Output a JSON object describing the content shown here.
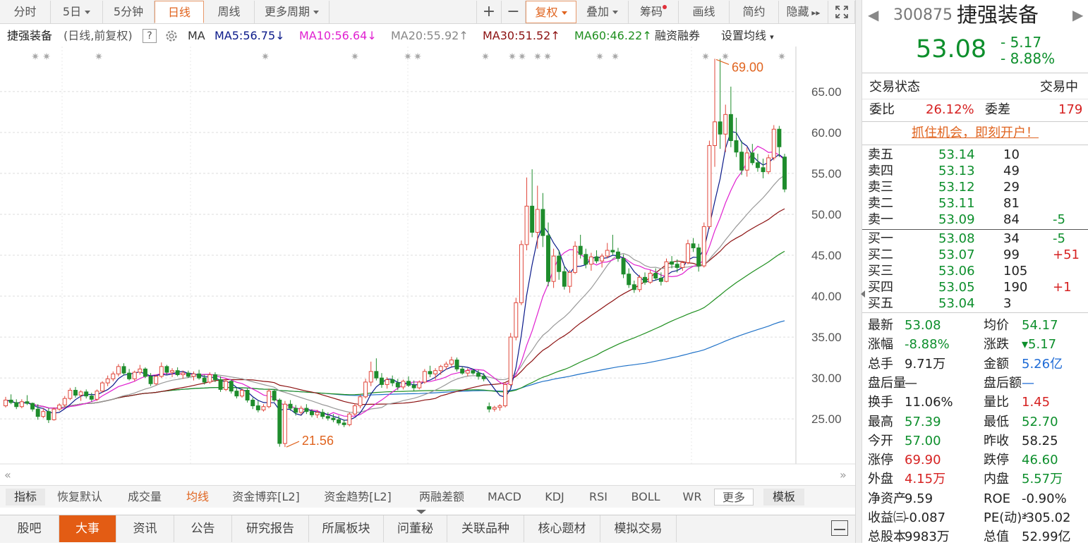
{
  "toolbar": {
    "tabs": [
      "分时",
      "5日",
      "5分钟",
      "日线",
      "周线",
      "更多周期"
    ],
    "zoom_in": "+",
    "zoom_out": "−",
    "fuquan": "复权",
    "diejia": "叠加",
    "chouma": "筹码",
    "huaxian": "画线",
    "jianyue": "简约",
    "yincang": "隐藏"
  },
  "ma_bar": {
    "name": "捷强装备",
    "mode": "(日线,前复权)",
    "help": "?",
    "ma_label": "MA",
    "ma5": "MA5:56.75",
    "ma10": "MA10:56.64",
    "ma20": "MA20:55.92",
    "ma30": "MA30:51.52",
    "ma60": "MA60:46.22",
    "rzrq": "融资融券",
    "setting": "设置均线",
    "ma5_arrow": "↓",
    "ma10_arrow": "↓",
    "ma20_arrow": "↑",
    "ma30_arrow": "↑",
    "ma60_arrow": "↑"
  },
  "colors": {
    "ma5": "#0b1a8a",
    "ma10": "#e020d0",
    "ma20": "#999999",
    "ma30": "#8b1010",
    "ma60": "#1f8f1f",
    "ma120": "#2072c8",
    "up": "#e0463a",
    "down": "#1e8c2c",
    "accent": "#e0641f"
  },
  "chart_data": {
    "type": "candlestick",
    "y_axis": {
      "ticks": [
        "65.00",
        "60.00",
        "55.00",
        "50.00",
        "45.00",
        "40.00",
        "35.00",
        "30.00",
        "25.00"
      ],
      "range": [
        19.5,
        70.5
      ]
    },
    "annotations": {
      "high": "69.00",
      "low": "21.56"
    },
    "candles": [
      [
        26.6,
        27.7,
        26.4,
        27.3
      ],
      [
        27.3,
        28.0,
        26.8,
        27.0
      ],
      [
        27.0,
        27.4,
        26.2,
        26.5
      ],
      [
        26.5,
        27.4,
        26.3,
        27.1
      ],
      [
        27.1,
        27.9,
        26.7,
        26.9
      ],
      [
        26.9,
        27.0,
        25.9,
        26.2
      ],
      [
        26.2,
        26.8,
        24.9,
        25.3
      ],
      [
        25.3,
        26.3,
        25.1,
        25.9
      ],
      [
        25.9,
        26.3,
        24.5,
        24.9
      ],
      [
        24.9,
        26.4,
        24.8,
        26.2
      ],
      [
        26.2,
        26.9,
        26.0,
        26.7
      ],
      [
        26.7,
        27.8,
        26.4,
        27.5
      ],
      [
        27.5,
        28.8,
        27.3,
        28.5
      ],
      [
        28.5,
        28.9,
        27.6,
        27.9
      ],
      [
        27.9,
        28.5,
        27.2,
        28.3
      ],
      [
        28.3,
        28.6,
        27.5,
        27.8
      ],
      [
        27.8,
        28.2,
        27.1,
        27.4
      ],
      [
        27.4,
        28.6,
        27.2,
        28.4
      ],
      [
        28.4,
        29.6,
        28.2,
        29.4
      ],
      [
        29.4,
        30.3,
        29.0,
        29.9
      ],
      [
        29.9,
        30.8,
        29.6,
        30.5
      ],
      [
        30.5,
        31.7,
        30.2,
        31.4
      ],
      [
        31.4,
        31.8,
        30.3,
        30.6
      ],
      [
        30.6,
        31.1,
        29.7,
        29.9
      ],
      [
        29.9,
        30.9,
        29.6,
        30.7
      ],
      [
        30.7,
        31.6,
        30.4,
        31.1
      ],
      [
        31.1,
        31.3,
        30.0,
        30.2
      ],
      [
        30.2,
        30.6,
        29.0,
        29.3
      ],
      [
        29.3,
        30.4,
        29.1,
        30.2
      ],
      [
        30.2,
        31.9,
        30.0,
        31.4
      ],
      [
        31.4,
        31.6,
        30.4,
        30.7
      ],
      [
        30.7,
        31.2,
        30.1,
        30.9
      ],
      [
        30.9,
        31.3,
        30.2,
        30.4
      ],
      [
        30.4,
        30.9,
        29.9,
        30.6
      ],
      [
        30.6,
        30.9,
        30.0,
        30.2
      ],
      [
        30.2,
        30.8,
        29.7,
        30.5
      ],
      [
        30.5,
        31.0,
        29.8,
        30.0
      ],
      [
        30.0,
        30.4,
        29.2,
        29.5
      ],
      [
        29.5,
        30.7,
        29.3,
        30.4
      ],
      [
        30.4,
        30.7,
        29.5,
        29.8
      ],
      [
        29.8,
        30.2,
        28.3,
        28.6
      ],
      [
        28.6,
        29.9,
        28.4,
        29.6
      ],
      [
        29.6,
        29.8,
        28.1,
        28.4
      ],
      [
        28.4,
        28.8,
        27.5,
        27.8
      ],
      [
        27.8,
        28.7,
        27.6,
        28.5
      ],
      [
        28.5,
        28.7,
        27.0,
        27.3
      ],
      [
        27.3,
        27.6,
        26.2,
        26.6
      ],
      [
        26.6,
        27.2,
        25.8,
        26.1
      ],
      [
        26.1,
        26.8,
        25.9,
        26.5
      ],
      [
        26.5,
        28.7,
        26.3,
        28.4
      ],
      [
        28.4,
        28.6,
        27.1,
        27.3
      ],
      [
        27.3,
        27.5,
        21.6,
        22.0
      ],
      [
        22.0,
        27.2,
        21.56,
        26.8
      ],
      [
        26.8,
        27.3,
        26.0,
        26.3
      ],
      [
        26.3,
        26.7,
        25.4,
        25.8
      ],
      [
        25.8,
        26.6,
        25.5,
        26.3
      ],
      [
        26.3,
        26.8,
        25.6,
        25.9
      ],
      [
        25.9,
        26.2,
        25.2,
        25.5
      ],
      [
        25.5,
        26.1,
        25.1,
        25.8
      ],
      [
        25.8,
        26.2,
        25.0,
        25.3
      ],
      [
        25.3,
        25.8,
        24.8,
        25.1
      ],
      [
        25.1,
        25.6,
        24.6,
        24.9
      ],
      [
        24.9,
        25.4,
        24.2,
        24.5
      ],
      [
        24.5,
        24.9,
        24.0,
        24.3
      ],
      [
        24.3,
        25.8,
        24.1,
        25.6
      ],
      [
        25.6,
        26.9,
        25.4,
        26.6
      ],
      [
        26.6,
        28.0,
        26.3,
        27.7
      ],
      [
        27.7,
        29.9,
        27.5,
        29.5
      ],
      [
        29.5,
        32.0,
        29.0,
        30.8
      ],
      [
        30.8,
        32.4,
        29.7,
        30.0
      ],
      [
        30.0,
        30.6,
        28.8,
        29.2
      ],
      [
        29.2,
        30.1,
        28.7,
        29.8
      ],
      [
        29.8,
        30.3,
        29.0,
        29.4
      ],
      [
        29.4,
        29.9,
        28.5,
        28.9
      ],
      [
        28.9,
        29.8,
        28.6,
        29.6
      ],
      [
        29.6,
        30.2,
        28.9,
        29.1
      ],
      [
        29.1,
        29.7,
        28.4,
        28.8
      ],
      [
        28.8,
        29.7,
        28.6,
        29.5
      ],
      [
        29.5,
        31.1,
        29.3,
        30.8
      ],
      [
        30.8,
        31.5,
        30.1,
        30.5
      ],
      [
        30.5,
        31.2,
        29.8,
        30.9
      ],
      [
        30.9,
        31.6,
        30.4,
        31.4
      ],
      [
        31.4,
        32.0,
        31.0,
        31.7
      ],
      [
        31.7,
        32.6,
        31.4,
        32.2
      ],
      [
        32.2,
        32.5,
        30.8,
        31.1
      ],
      [
        31.1,
        31.4,
        30.4,
        30.6
      ],
      [
        30.6,
        31.2,
        30.2,
        30.9
      ],
      [
        30.9,
        31.1,
        30.4,
        30.6
      ],
      [
        30.6,
        31.0,
        29.8,
        30.2
      ],
      [
        30.2,
        30.6,
        29.6,
        29.9
      ],
      [
        26.5,
        27.0,
        25.8,
        26.2
      ],
      [
        26.2,
        26.6,
        25.9,
        26.4
      ],
      [
        26.4,
        26.8,
        26.0,
        26.6
      ],
      [
        26.6,
        29.5,
        26.4,
        29.2
      ],
      [
        29.2,
        35.5,
        29.0,
        35.0
      ],
      [
        35.0,
        39.8,
        34.6,
        39.2
      ],
      [
        39.2,
        46.8,
        38.9,
        46.3
      ],
      [
        46.3,
        54.5,
        45.6,
        51.0
      ],
      [
        51.0,
        55.5,
        47.2,
        47.8
      ],
      [
        47.8,
        53.5,
        45.8,
        50.6
      ],
      [
        50.6,
        52.6,
        46.0,
        47.4
      ],
      [
        47.4,
        49.0,
        41.2,
        41.8
      ],
      [
        41.8,
        45.8,
        41.0,
        44.9
      ],
      [
        44.9,
        45.6,
        42.0,
        43.0
      ],
      [
        43.0,
        43.7,
        40.8,
        41.2
      ],
      [
        41.2,
        43.2,
        40.4,
        42.9
      ],
      [
        42.9,
        46.7,
        42.7,
        46.1
      ],
      [
        46.1,
        47.5,
        44.6,
        45.1
      ],
      [
        45.1,
        45.8,
        43.4,
        43.9
      ],
      [
        43.9,
        45.3,
        43.1,
        44.8
      ],
      [
        44.8,
        45.6,
        44.0,
        44.3
      ],
      [
        44.3,
        45.2,
        43.5,
        44.9
      ],
      [
        44.9,
        46.5,
        44.6,
        45.6
      ],
      [
        45.6,
        47.5,
        45.0,
        45.4
      ],
      [
        45.4,
        45.9,
        44.2,
        44.6
      ],
      [
        44.6,
        45.1,
        42.2,
        42.7
      ],
      [
        42.7,
        43.4,
        41.0,
        41.4
      ],
      [
        41.4,
        41.9,
        40.4,
        40.8
      ],
      [
        40.8,
        42.6,
        40.5,
        42.3
      ],
      [
        42.3,
        42.9,
        41.4,
        41.7
      ],
      [
        41.7,
        43.2,
        41.5,
        42.8
      ],
      [
        42.8,
        43.4,
        41.9,
        42.2
      ],
      [
        42.2,
        42.9,
        41.3,
        41.8
      ],
      [
        41.8,
        44.6,
        41.7,
        44.2
      ],
      [
        44.2,
        44.9,
        43.4,
        43.9
      ],
      [
        43.9,
        44.5,
        42.9,
        43.5
      ],
      [
        43.5,
        44.3,
        43.1,
        44.1
      ],
      [
        44.1,
        46.9,
        43.9,
        46.4
      ],
      [
        46.4,
        47.1,
        45.4,
        45.9
      ],
      [
        45.9,
        46.4,
        43.0,
        43.7
      ],
      [
        43.7,
        49.0,
        43.5,
        48.5
      ],
      [
        48.5,
        59.0,
        48.2,
        58.4
      ],
      [
        58.4,
        69.0,
        55.8,
        61.3
      ],
      [
        61.3,
        69.0,
        58.0,
        59.8
      ],
      [
        59.8,
        63.4,
        57.6,
        62.2
      ],
      [
        62.2,
        65.6,
        58.2,
        59.0
      ],
      [
        59.0,
        61.8,
        57.0,
        57.6
      ],
      [
        57.6,
        59.0,
        54.8,
        55.4
      ],
      [
        55.4,
        58.2,
        54.6,
        57.5
      ],
      [
        57.5,
        58.6,
        56.0,
        56.3
      ],
      [
        56.3,
        57.4,
        55.2,
        55.7
      ],
      [
        55.7,
        56.8,
        54.4,
        55.2
      ],
      [
        55.2,
        57.3,
        54.9,
        56.9
      ],
      [
        56.9,
        60.9,
        56.6,
        60.4
      ],
      [
        60.4,
        60.8,
        57.0,
        58.25
      ],
      [
        57.0,
        57.39,
        52.7,
        53.08
      ]
    ]
  },
  "indicators": {
    "tabs": [
      "指标",
      "恢复默认",
      "成交量",
      "均线",
      "资金博弈[L2]",
      "资金趋势[L2]",
      "两融差额",
      "MACD",
      "KDJ",
      "RSI",
      "BOLL",
      "WR",
      "更多",
      "模板"
    ]
  },
  "bottom_tabs": [
    "股吧",
    "大事",
    "资讯",
    "公告",
    "研究报告",
    "所属板块",
    "问董秘",
    "关联品种",
    "核心题材",
    "模拟交易"
  ],
  "quote": {
    "code": "300875",
    "name": "捷强装备",
    "price": "53.08",
    "change": "- 5.17",
    "pct": "- 8.88%",
    "status_label": "交易状态",
    "status": "交易中",
    "wb_label": "委比",
    "wb": "26.12%",
    "wc_label": "委差",
    "wc": "179",
    "promo": "抓住机会，即刻开户！"
  },
  "asks": [
    {
      "label": "卖五",
      "price": "53.14",
      "vol": "10",
      "chg": ""
    },
    {
      "label": "卖四",
      "price": "53.13",
      "vol": "49",
      "chg": ""
    },
    {
      "label": "卖三",
      "price": "53.12",
      "vol": "29",
      "chg": ""
    },
    {
      "label": "卖二",
      "price": "53.11",
      "vol": "81",
      "chg": ""
    },
    {
      "label": "卖一",
      "price": "53.09",
      "vol": "84",
      "chg": "-5"
    }
  ],
  "bids": [
    {
      "label": "买一",
      "price": "53.08",
      "vol": "34",
      "chg": "-5"
    },
    {
      "label": "买二",
      "price": "53.07",
      "vol": "99",
      "chg": "+51"
    },
    {
      "label": "买三",
      "price": "53.06",
      "vol": "105",
      "chg": ""
    },
    {
      "label": "买四",
      "price": "53.05",
      "vol": "190",
      "chg": "+1"
    },
    {
      "label": "买五",
      "price": "53.04",
      "vol": "3",
      "chg": ""
    }
  ],
  "stats": [
    [
      "最新",
      "53.08",
      "g",
      "均价",
      "54.17",
      "g"
    ],
    [
      "涨幅",
      "-8.88%",
      "g",
      "涨跌",
      "▾5.17",
      "g"
    ],
    [
      "总手",
      "9.71万",
      "k",
      "金额",
      "5.26亿",
      "b"
    ],
    [
      "盘后量",
      "—",
      "k",
      "盘后额",
      "—",
      "b"
    ],
    [
      "换手",
      "11.06%",
      "k",
      "量比",
      "1.45",
      "r"
    ],
    [
      "最高",
      "57.39",
      "g",
      "最低",
      "52.70",
      "g"
    ],
    [
      "今开",
      "57.00",
      "g",
      "昨收",
      "58.25",
      "k"
    ],
    [
      "涨停",
      "69.90",
      "r",
      "跌停",
      "46.60",
      "g"
    ],
    [
      "外盘",
      "4.15万",
      "r",
      "内盘",
      "5.57万",
      "g"
    ],
    [
      "净资产",
      "9.59",
      "k",
      "ROE",
      "-0.90%",
      "k"
    ],
    [
      "收益㈢",
      "-0.087",
      "k",
      "PE(动)*",
      "-305.02",
      "k"
    ],
    [
      "总股本",
      "9983万",
      "k",
      "总值",
      "52.99亿",
      "k"
    ]
  ]
}
